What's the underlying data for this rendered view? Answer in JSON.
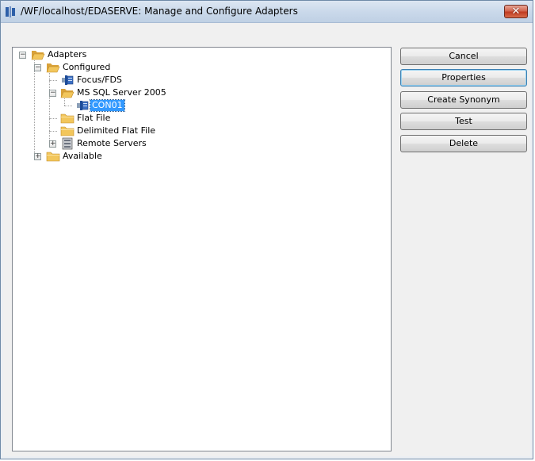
{
  "window": {
    "title": "/WF/localhost/EDASERVE: Manage and Configure Adapters",
    "close_glyph": "✕"
  },
  "tree": {
    "nodes": [
      {
        "label": "Adapters",
        "icon": "folder-open-icon"
      },
      {
        "label": "Configured",
        "icon": "folder-open-icon"
      },
      {
        "label": "Focus/FDS",
        "icon": "adapter-icon"
      },
      {
        "label": "MS SQL Server 2005",
        "icon": "folder-open-icon"
      },
      {
        "label": "CON01",
        "icon": "connection-icon",
        "selected": true
      },
      {
        "label": "Flat File",
        "icon": "folder-icon"
      },
      {
        "label": "Delimited Flat File",
        "icon": "folder-icon"
      },
      {
        "label": "Remote Servers",
        "icon": "server-icon"
      },
      {
        "label": "Available",
        "icon": "folder-icon"
      }
    ]
  },
  "buttons": {
    "cancel": "Cancel",
    "properties": "Properties",
    "create_synonym": "Create Synonym",
    "test": "Test",
    "delete": "Delete"
  },
  "colors": {
    "selection": "#3399ff",
    "folder": "#f2c65c"
  }
}
